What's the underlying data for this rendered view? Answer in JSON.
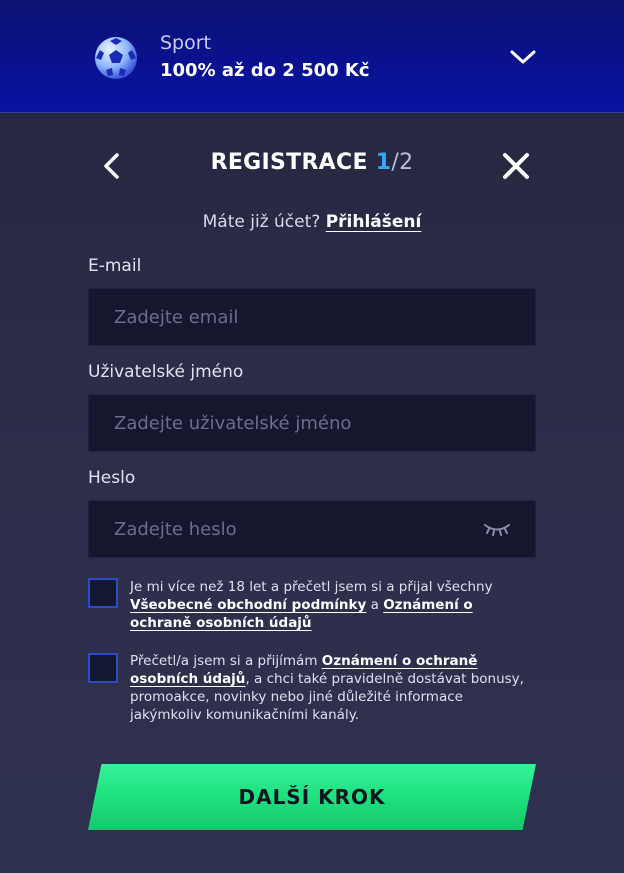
{
  "promo": {
    "category": "Sport",
    "bonus": "100% až do 2 500 Kč"
  },
  "header": {
    "title": "REGISTRACE",
    "step_current": "1",
    "step_separator": "/",
    "step_total": "2"
  },
  "account": {
    "question": "Máte již účet?",
    "login_link": "Přihlášení"
  },
  "form": {
    "email": {
      "label": "E-mail",
      "placeholder": "Zadejte email",
      "value": ""
    },
    "username": {
      "label": "Uživatelské jméno",
      "placeholder": "Zadejte uživatelské jméno",
      "value": ""
    },
    "password": {
      "label": "Heslo",
      "placeholder": "Zadejte heslo",
      "value": ""
    }
  },
  "consents": {
    "terms": {
      "text_before": "Je mi více než 18 let a přečetl jsem si a přijal všechny ",
      "link1": "Všeobecné obchodní podmínky",
      "text_middle": " a ",
      "link2": "Oznámení o ochraně osobních údajů",
      "checked": false
    },
    "marketing": {
      "text_before": "Přečetl/a jsem si a přijímám ",
      "link1": "Oznámení o ochraně osobních údajů",
      "text_after": ", a chci také pravidelně dostávat bonusy, promoakce, novinky nebo jiné důležité informace jakýmkoliv komunikačními kanály.",
      "checked": false
    }
  },
  "actions": {
    "next_label": "DALŠÍ KROK"
  },
  "colors": {
    "accent_blue": "#30a9ff",
    "promo_blue": "#0a118f",
    "cta_green": "#1ee07e"
  },
  "icons": {
    "promo": "soccer-ball-icon",
    "expand": "chevron-down-icon",
    "back": "chevron-left-icon",
    "close": "close-icon",
    "password_toggle": "eye-closed-icon"
  }
}
